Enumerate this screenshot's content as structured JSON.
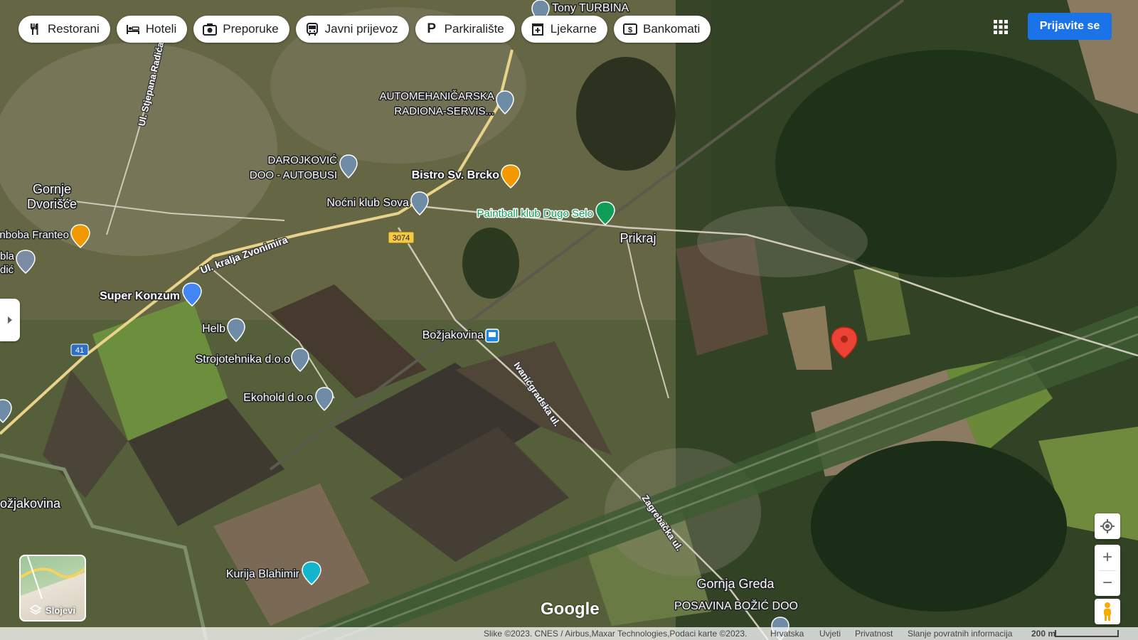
{
  "chips": [
    {
      "label": "Restorani",
      "icon": "fork-knife-icon"
    },
    {
      "label": "Hoteli",
      "icon": "bed-icon"
    },
    {
      "label": "Preporuke",
      "icon": "camera-icon"
    },
    {
      "label": "Javni prijevoz",
      "icon": "bus-icon"
    },
    {
      "label": "Parkiralište",
      "icon": "parking-icon"
    },
    {
      "label": "Ljekarne",
      "icon": "pharmacy-icon"
    },
    {
      "label": "Bankomati",
      "icon": "atm-icon"
    }
  ],
  "header": {
    "signin_label": "Prijavite se",
    "apps_icon": "grid-apps-icon"
  },
  "map": {
    "places": {
      "tony": "Tony TURBINA",
      "automeh1": "AUTOMEHANIČARSKA",
      "automeh2": "RADIONA-SERVIS...",
      "darojkovic1": "DAROJKOVIĆ",
      "darojkovic2": "DOO - AUTOBUSI",
      "bistro": "Bistro Sv. Brcko",
      "nocni": "Noćni klub Sova",
      "paintball": "Paintball klub Dugo Selo",
      "gornje1": "Gornje",
      "gornje2": "Dvorišće",
      "franteo": "nboba Franteo",
      "bola1": "bla",
      "bola2": "dić",
      "superkonzum": "Super Konzum",
      "helb": "Helb",
      "strojo": "Strojotehnika d.o.o",
      "ekohold": "Ekohold d.o.o",
      "bozjakovina_stop": "Božjakovina",
      "bozjakovina": "ožjakovina",
      "prikraj": "Prikraj",
      "kurija": "Kurija Blahimir",
      "gornjagreda": "Gornja Greda",
      "posavina": "POSAVINA BOŽIĆ DOO"
    },
    "roads": {
      "stjepana": "Ul. Stjepana Radića",
      "zvonimira": "Ul. kralja Zvonimira",
      "ivanicgradska": "Ivanićgradska ul.",
      "zagrebacka": "Zagrebačka ul.",
      "shield_3074": "3074",
      "shield_41": "41"
    }
  },
  "controls": {
    "layers_label": "Slojevi",
    "locate_icon": "my-location-icon",
    "zoom_in": "+",
    "zoom_out": "−",
    "pegman_icon": "pegman-icon"
  },
  "footer": {
    "logo": "Google",
    "attribution": "Slike ©2023. CNES / Airbus,Maxar Technologies,Podaci karte ©2023.",
    "country": "Hrvatska",
    "terms": "Uvjeti",
    "privacy": "Privatnost",
    "feedback": "Slanje povratnih informacija",
    "scale": "200 m"
  },
  "colors": {
    "accent_blue": "#1a73e8",
    "pin_red": "#ea4335",
    "poi_gray": "#6f8ca7",
    "food_orange": "#f29900",
    "park_green": "#0f9d58",
    "shop_blue": "#4285f4",
    "transit_blue": "#1e88e5",
    "tourism_teal": "#12b5cb"
  }
}
